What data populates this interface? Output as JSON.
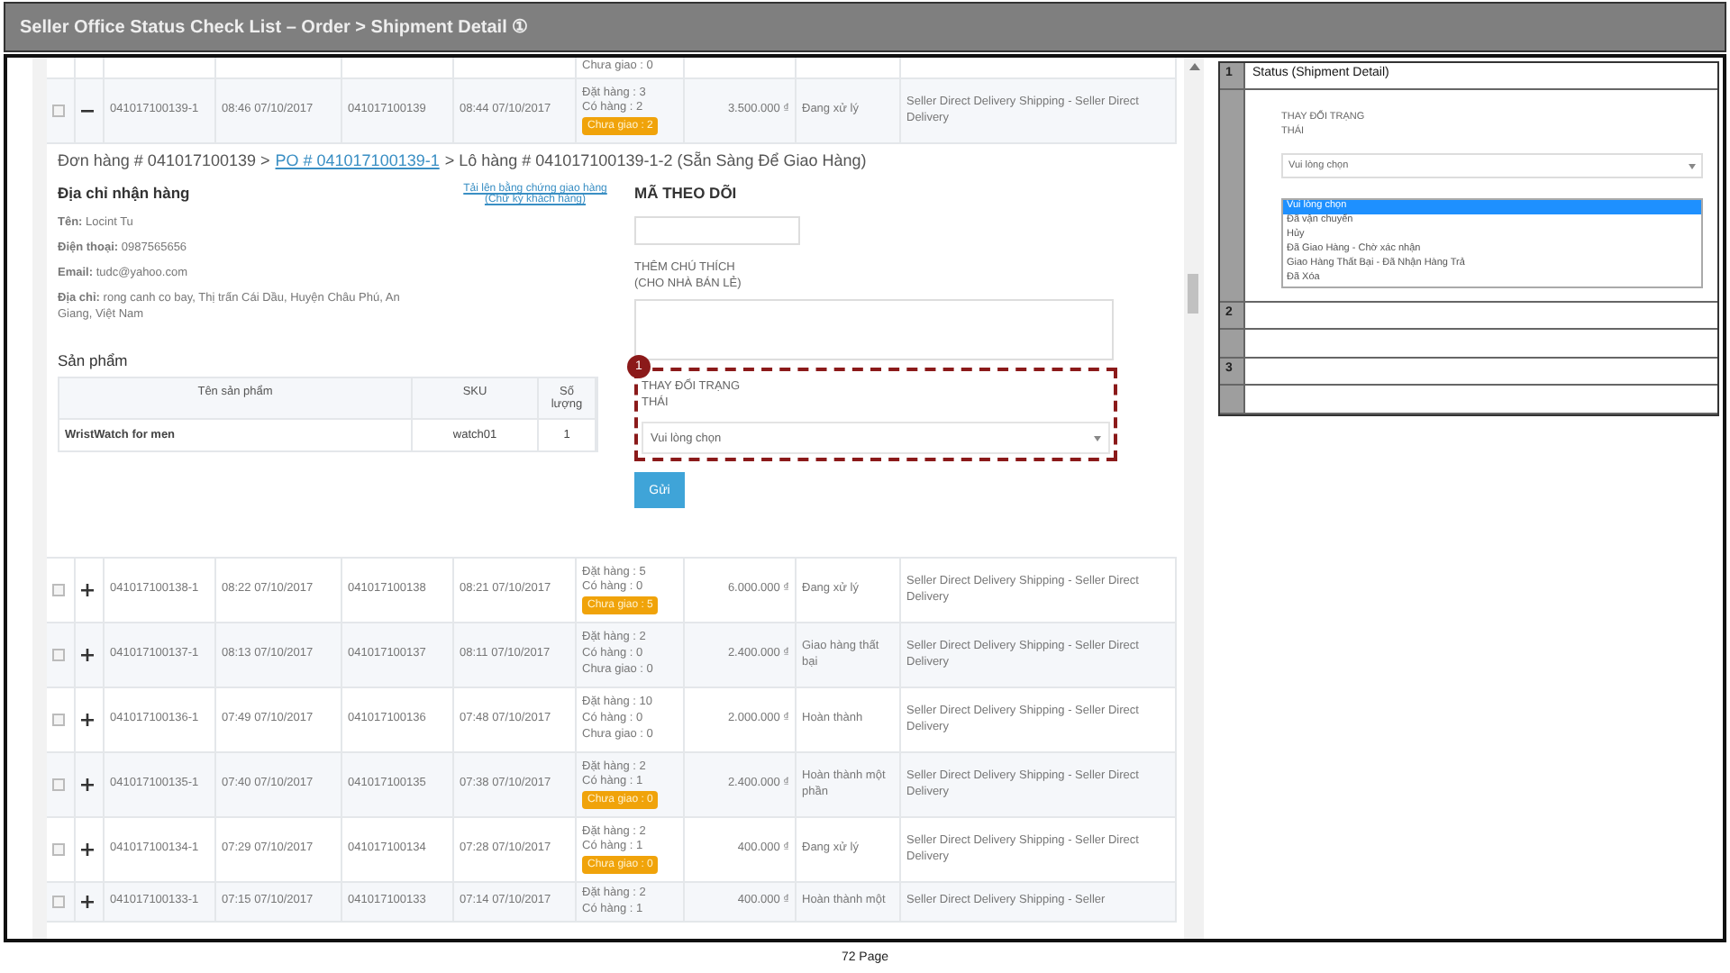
{
  "document": {
    "title": "Seller Office Status Check List – Order > Shipment Detail ①",
    "page": "72 Page"
  },
  "top_cut_row": {
    "quantity": "Chưa giao : 0"
  },
  "rows_before": [
    {
      "checked": false,
      "expanded": true,
      "id": "041017100139-1",
      "created": "08:46 07/10/2017",
      "order_id": "041017100139",
      "ordered": "08:44 07/10/2017",
      "quantity": [
        "Đặt hàng : 3",
        "Có hàng : 2"
      ],
      "pending": "Chưa giao : 2",
      "pending_badge": true,
      "amount": "3.500.000 ₫",
      "status": "Đang xử lý",
      "shipping": "Seller Direct Delivery Shipping - Seller Direct Delivery"
    }
  ],
  "detail": {
    "breadcrumb": {
      "order": "Đơn hàng # 041017100139 >",
      "po_link": "PO # 041017100139-1",
      "lot": "> Lô hàng # 041017100139-1-2 (Sẵn Sàng Để Giao Hàng)"
    },
    "address_title": "Địa chỉ nhận hàng",
    "upload_link": "Tải lên bằng chứng giao hàng (Chữ ký khách hàng)",
    "address_lines": [
      "**Tên:** Locint Tu",
      "**Điện thoại:** 0987565656",
      "**Email:** tudc@yahoo.com",
      "**Địa chỉ:** rong canh co bay, Thị trấn Cái Dầu, Huyện Châu Phú, An Giang, Việt Nam"
    ],
    "products_title": "Sản phẩm",
    "product_columns": [
      "Tên sản phẩm",
      "SKU",
      "Số lượng"
    ],
    "product_rows": [
      [
        "WristWatch for men",
        "watch01",
        "1"
      ]
    ],
    "tracking_label": "MÃ THEO DÕI",
    "note_label": "THÊM CHÚ THÍCH (CHO NHÀ BÁN LẺ)",
    "status_label": "THAY ĐỔI TRẠNG THÁI",
    "status_select": "Vui lòng chọn",
    "callout_marker": "1",
    "submit": "Gửi"
  },
  "rows_after": [
    {
      "checked": false,
      "expanded": false,
      "id": "041017100138-1",
      "created": "08:22 07/10/2017",
      "order_id": "041017100138",
      "ordered": "08:21 07/10/2017",
      "quantity": [
        "Đặt hàng : 5",
        "Có hàng : 0"
      ],
      "pending": "Chưa giao : 5",
      "pending_badge": true,
      "amount": "6.000.000 ₫",
      "status": "Đang xử lý",
      "shipping": "Seller Direct Delivery Shipping - Seller Direct Delivery"
    },
    {
      "checked": false,
      "expanded": false,
      "id": "041017100137-1",
      "created": "08:13 07/10/2017",
      "order_id": "041017100137",
      "ordered": "08:11 07/10/2017",
      "quantity": [
        "Đặt hàng : 2",
        "Có hàng : 0"
      ],
      "pending": "Chưa giao : 0",
      "pending_badge": false,
      "amount": "2.400.000 ₫",
      "status": "Giao hàng thất bại",
      "shipping": "Seller Direct Delivery Shipping - Seller Direct Delivery"
    },
    {
      "checked": false,
      "expanded": false,
      "id": "041017100136-1",
      "created": "07:49 07/10/2017",
      "order_id": "041017100136",
      "ordered": "07:48 07/10/2017",
      "quantity": [
        "Đặt hàng : 10",
        "Có hàng : 0"
      ],
      "pending": "Chưa giao : 0",
      "pending_badge": false,
      "amount": "2.000.000 ₫",
      "status": "Hoàn thành",
      "shipping": "Seller Direct Delivery Shipping - Seller Direct Delivery"
    },
    {
      "checked": false,
      "expanded": false,
      "id": "041017100135-1",
      "created": "07:40 07/10/2017",
      "order_id": "041017100135",
      "ordered": "07:38 07/10/2017",
      "quantity": [
        "Đặt hàng : 2",
        "Có hàng : 1"
      ],
      "pending": "Chưa giao : 0",
      "pending_badge": true,
      "amount": "2.400.000 ₫",
      "status": "Hoàn thành một phần",
      "shipping": "Seller Direct Delivery Shipping - Seller Direct Delivery"
    },
    {
      "checked": false,
      "expanded": false,
      "id": "041017100134-1",
      "created": "07:29 07/10/2017",
      "order_id": "041017100134",
      "ordered": "07:28 07/10/2017",
      "quantity": [
        "Đặt hàng : 2",
        "Có hàng : 1"
      ],
      "pending": "Chưa giao : 0",
      "pending_badge": true,
      "amount": "400.000 ₫",
      "status": "Đang xử lý",
      "shipping": "Seller Direct Delivery Shipping - Seller Direct Delivery"
    },
    {
      "checked": false,
      "expanded": false,
      "id": "041017100133-1",
      "created": "07:15 07/10/2017",
      "order_id": "041017100133",
      "ordered": "07:14 07/10/2017",
      "quantity": [
        "Đặt hàng : 2",
        "Có hàng : 1"
      ],
      "amount": "400.000 ₫",
      "status": "Hoàn thành một",
      "shipping": "Seller Direct Delivery Shipping - Seller"
    }
  ],
  "spec_table": {
    "rows": [
      {
        "number": "1",
        "title": "Status (Shipment Detail)",
        "preview": {
          "label": "THAY ĐỔI TRẠNG THÁI",
          "select": "Vui lòng chọn",
          "options": [
            {
              "label": "Vui lòng chọn",
              "selected": true
            },
            {
              "label": "Đã vận chuyển",
              "selected": false
            },
            {
              "label": "Hủy",
              "selected": false
            },
            {
              "label": "Đã Giao Hàng - Chờ xác nhận",
              "selected": false
            },
            {
              "label": "Giao Hàng Thất Bại - Đã Nhận Hàng Trả",
              "selected": false
            },
            {
              "label": "Đã Xóa",
              "selected": false
            }
          ]
        }
      },
      {
        "number": "2"
      },
      {
        "number": "3"
      }
    ]
  }
}
